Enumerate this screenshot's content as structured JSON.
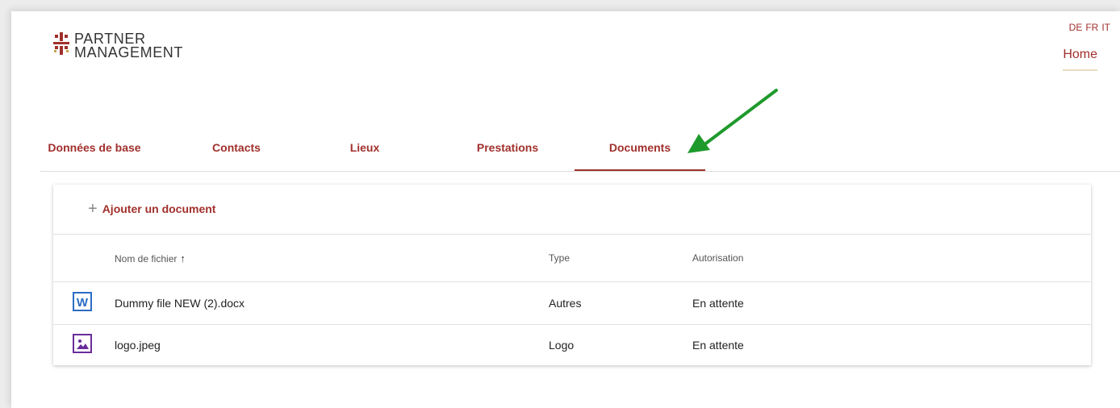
{
  "logo": {
    "line1": "PARTNER",
    "line2": "MANAGEMENT",
    "icon": "swiss-cross-logo-icon"
  },
  "languages": [
    "DE",
    "FR",
    "IT"
  ],
  "nav": {
    "home": "Home"
  },
  "tabs": [
    {
      "label": "Données de base",
      "active": false
    },
    {
      "label": "Contacts",
      "active": false
    },
    {
      "label": "Lieux",
      "active": false
    },
    {
      "label": "Prestations",
      "active": false
    },
    {
      "label": "Documents",
      "active": true
    }
  ],
  "documents": {
    "add_label": "Ajouter un document",
    "add_icon": "plus-icon",
    "columns": {
      "filename": "Nom de fichier",
      "type": "Type",
      "authorization": "Autorisation"
    },
    "sort_icon": "arrow-up-icon",
    "rows": [
      {
        "icon": "word-document-icon",
        "filename": "Dummy file NEW (2).docx",
        "type": "Autres",
        "authorization": "En attente"
      },
      {
        "icon": "image-file-icon",
        "filename": "logo.jpeg",
        "type": "Logo",
        "authorization": "En attente"
      }
    ]
  },
  "colors": {
    "accent": "#a0302c",
    "arrow": "#1e9a2c",
    "word": "#2b6cc4",
    "image": "#6a2c9a"
  }
}
